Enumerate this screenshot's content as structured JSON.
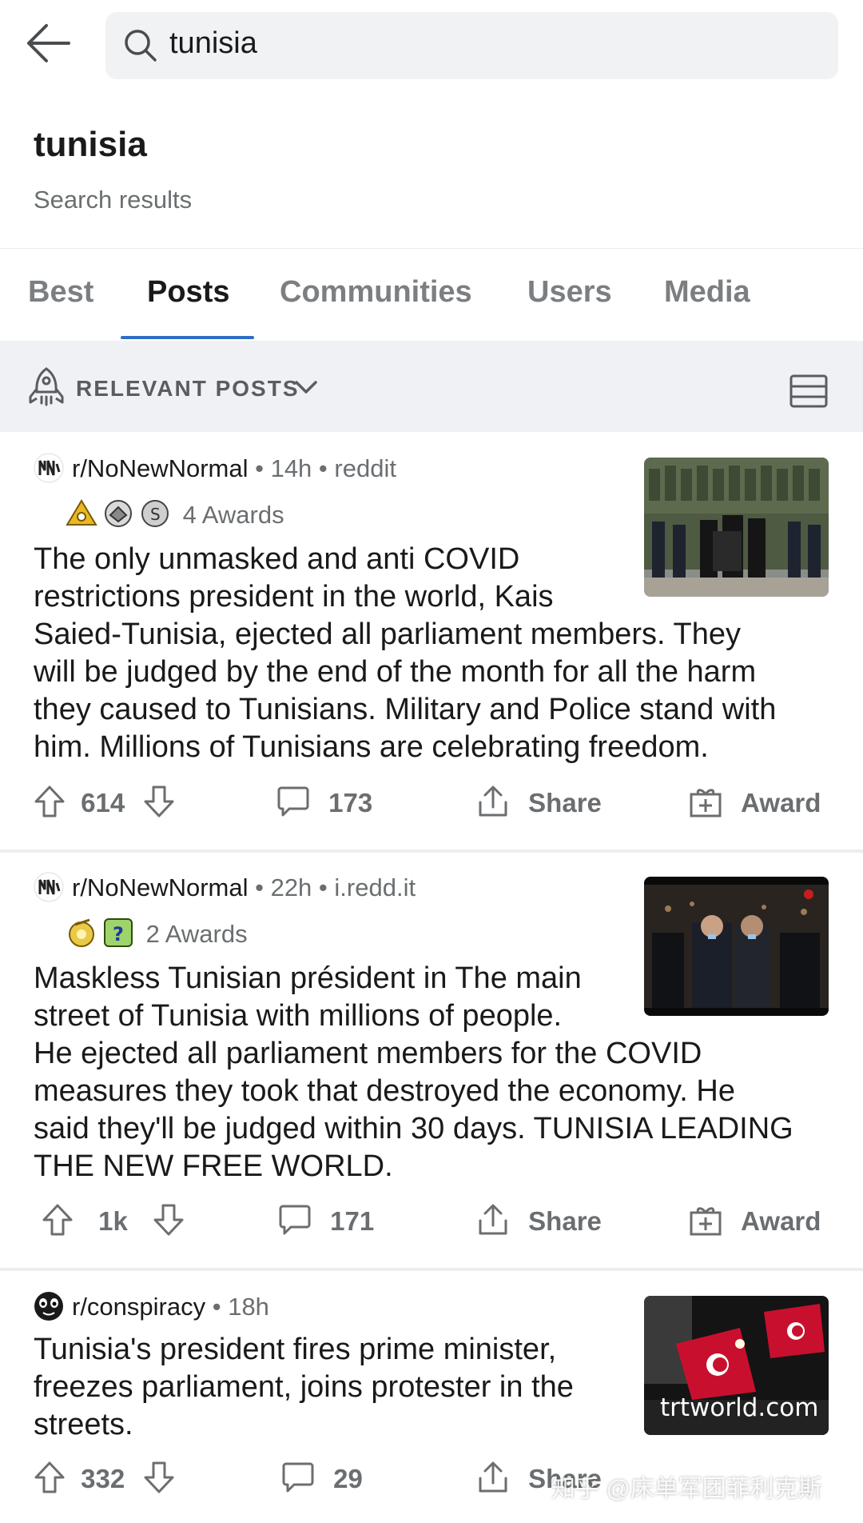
{
  "search": {
    "query": "tunisia"
  },
  "header": {
    "title": "tunisia",
    "subtitle": "Search results"
  },
  "tabs": [
    {
      "label": "Best"
    },
    {
      "label": "Posts"
    },
    {
      "label": "Communities"
    },
    {
      "label": "Users"
    },
    {
      "label": "Media"
    }
  ],
  "active_tab": "Posts",
  "sort": {
    "label": "RELEVANT POSTS"
  },
  "posts": [
    {
      "subreddit": "r/NoNewNormal",
      "age": "14h",
      "domain": "reddit",
      "awards": "4 Awards",
      "title": "The only unmasked and anti COVID restrictions president in the world, Kais Saied-Tunisia, ejected all parliament members. They will be judged by the end of the month for all the harm they caused to Tunisians. Military and Police stand with him. Millions of Tunisians are celebrating freedom.",
      "title_lines": [
        "The only unmasked and anti COVID",
        "restrictions president in the world, Kais",
        "Saied-Tunisia, ejected all parliament members. They",
        "will be judged by the end of the month for all the harm",
        "they caused to Tunisians. Military and Police stand with",
        "him. Millions of Tunisians are celebrating freedom."
      ],
      "upvotes": "614",
      "comments": "173",
      "share": "Share",
      "award": "Award"
    },
    {
      "subreddit": "r/NoNewNormal",
      "age": "22h",
      "domain": "i.redd.it",
      "awards": "2 Awards",
      "title_lines": [
        "Maskless Tunisian président in The main",
        "street of Tunisia with millions of people.",
        "He ejected all parliament members for the COVID",
        "measures they took that destroyed the economy. He",
        "said they'll be judged within 30 days. TUNISIA LEADING",
        "THE NEW FREE WORLD."
      ],
      "upvotes": "1k",
      "comments": "171",
      "share": "Share",
      "award": "Award"
    },
    {
      "subreddit": "r/conspiracy",
      "age": "18h",
      "thumb_caption": "trtworld.com",
      "title_lines": [
        "Tunisia's president fires prime minister,",
        "freezes parliament, joins protester in the",
        "streets."
      ],
      "upvotes": "332",
      "comments": "29",
      "share": "Share"
    }
  ],
  "watermark": "知乎 @床单军团菲利克斯",
  "colors": {
    "accent": "#2d6ec7",
    "tunisia_red": "#d7141a"
  }
}
